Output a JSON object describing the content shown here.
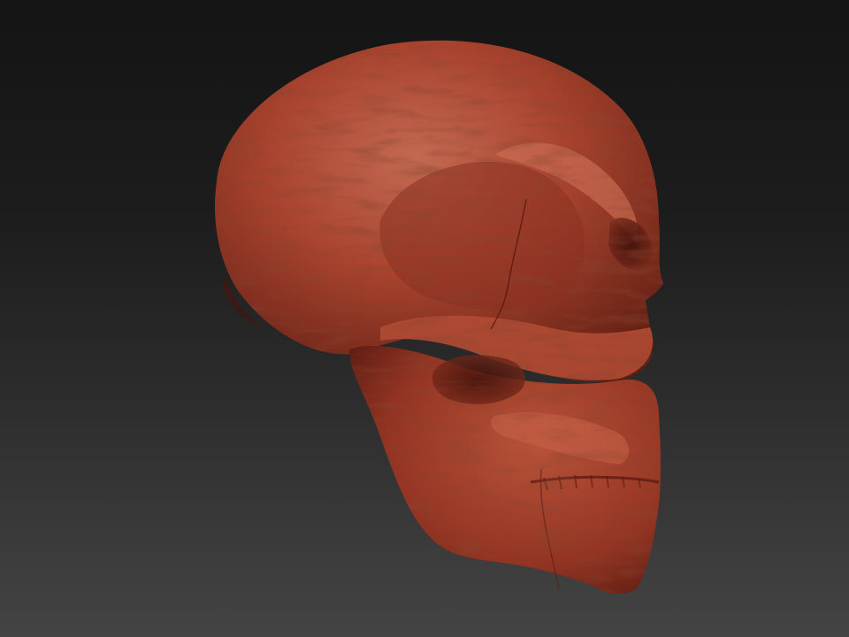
{
  "scene": {
    "subject_icon": "skull-sculpt-icon",
    "material_color": "#a8432e",
    "highlight_color": "#c8644a",
    "shadow_color": "#5e1d12",
    "background_top": "#141414",
    "background_bottom": "#444444"
  }
}
